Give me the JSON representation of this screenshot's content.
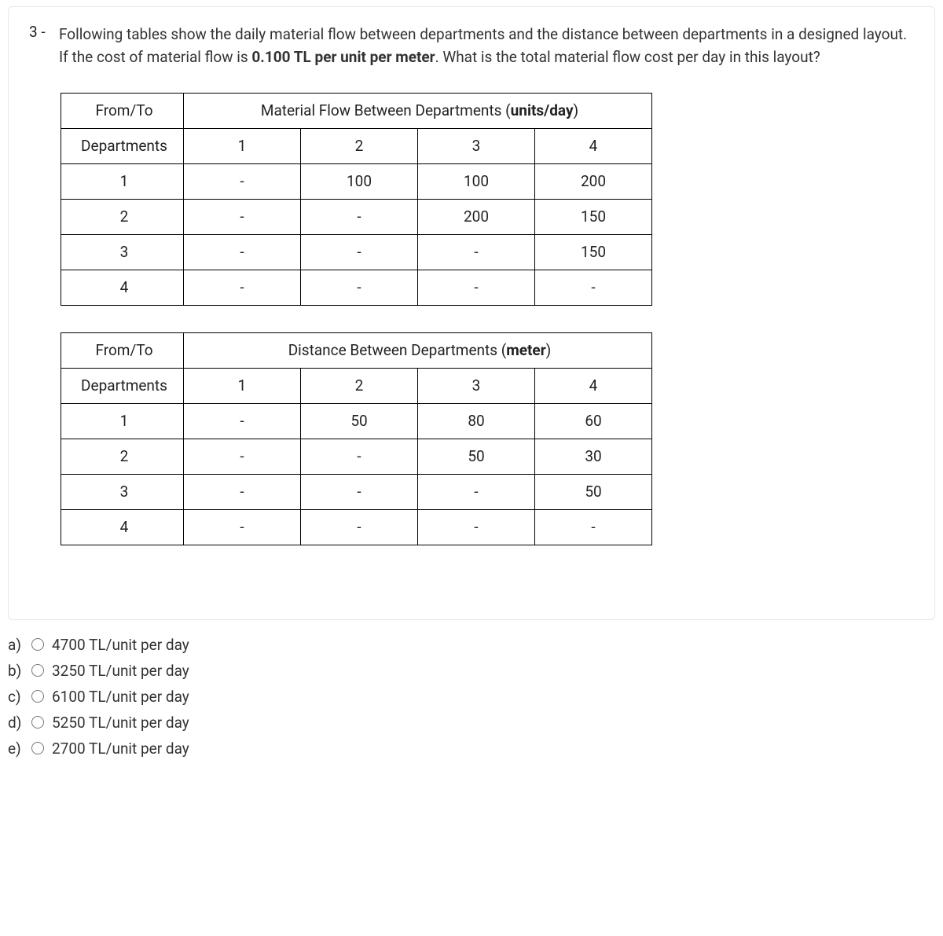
{
  "question": {
    "number": "3 -",
    "text_part1": "Following tables show the daily material flow between departments and the distance between departments in a designed layout. If the cost of material flow is ",
    "text_bold": "0.100 TL per unit per meter",
    "text_part2": ". What is the total material flow cost per day in this layout?"
  },
  "table1": {
    "header_left": "From/To",
    "header_span": "Material Flow Between Departments (units/day)",
    "dep_label": "Departments",
    "cols": [
      "1",
      "2",
      "3",
      "4"
    ],
    "rows": [
      {
        "label": "1",
        "cells": [
          "-",
          "100",
          "100",
          "200"
        ]
      },
      {
        "label": "2",
        "cells": [
          "-",
          "-",
          "200",
          "150"
        ]
      },
      {
        "label": "3",
        "cells": [
          "-",
          "-",
          "-",
          "150"
        ]
      },
      {
        "label": "4",
        "cells": [
          "-",
          "-",
          "-",
          "-"
        ]
      }
    ]
  },
  "table2": {
    "header_left": "From/To",
    "header_span": "Distance Between Departments (meter)",
    "dep_label": "Departments",
    "cols": [
      "1",
      "2",
      "3",
      "4"
    ],
    "rows": [
      {
        "label": "1",
        "cells": [
          "-",
          "50",
          "80",
          "60"
        ]
      },
      {
        "label": "2",
        "cells": [
          "-",
          "-",
          "50",
          "30"
        ]
      },
      {
        "label": "3",
        "cells": [
          "-",
          "-",
          "-",
          "50"
        ]
      },
      {
        "label": "4",
        "cells": [
          "-",
          "-",
          "-",
          "-"
        ]
      }
    ]
  },
  "options": [
    {
      "letter": "a)",
      "text": "4700 TL/unit per day"
    },
    {
      "letter": "b)",
      "text": "3250 TL/unit per day"
    },
    {
      "letter": "c)",
      "text": "6100 TL/unit per day"
    },
    {
      "letter": "d)",
      "text": "5250 TL/unit per day"
    },
    {
      "letter": "e)",
      "text": "2700 TL/unit per day"
    }
  ]
}
